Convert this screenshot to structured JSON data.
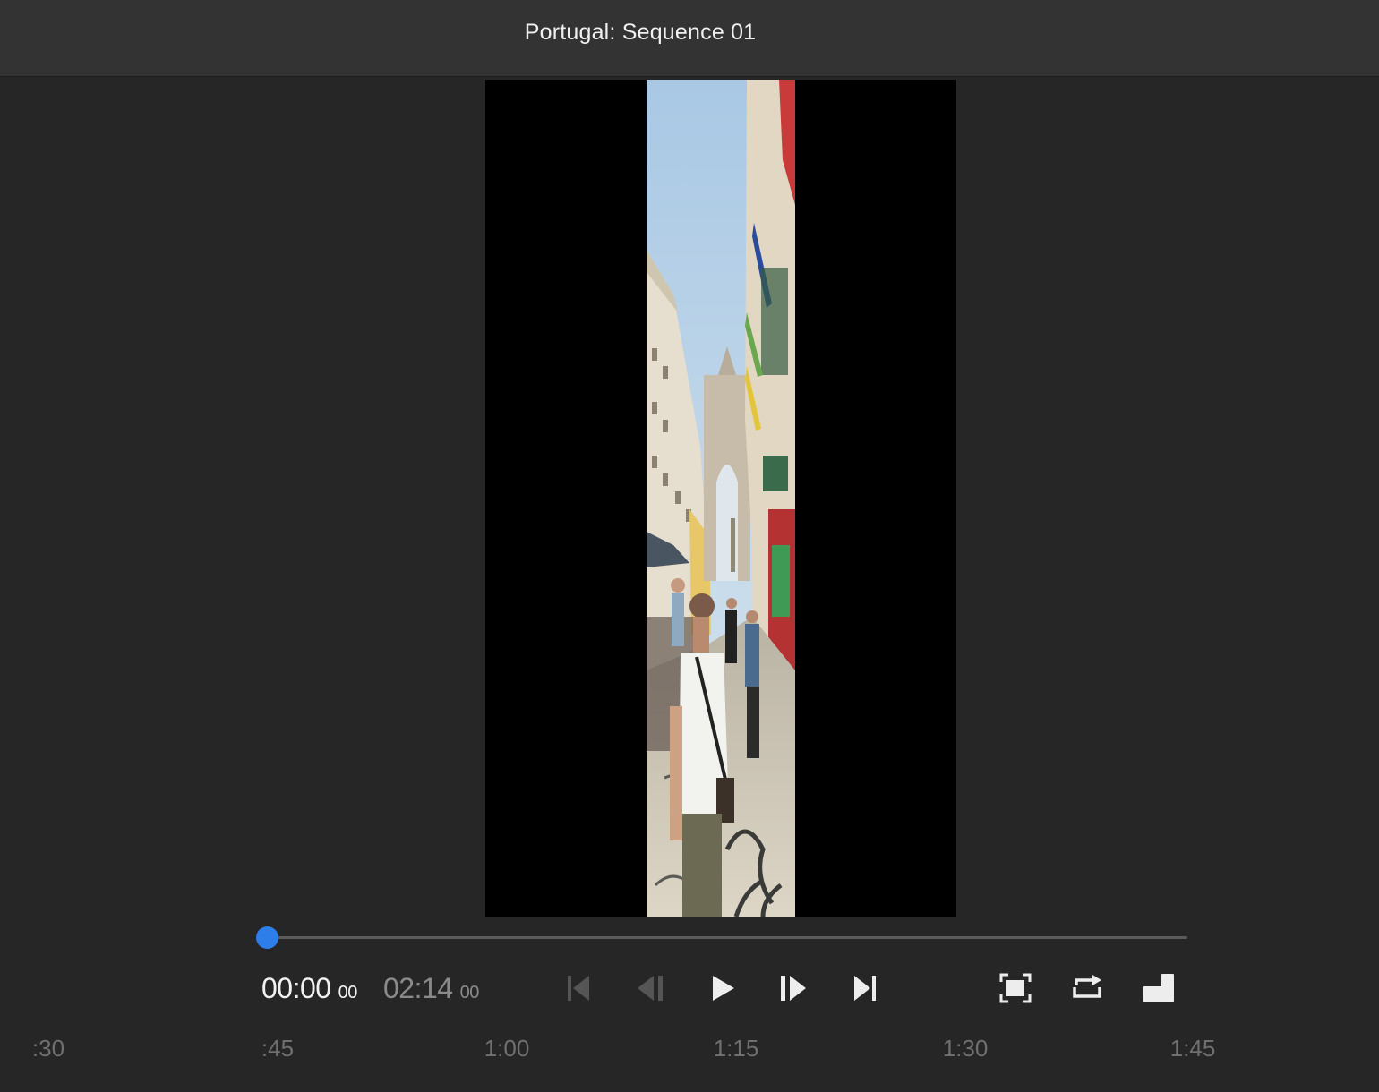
{
  "window": {
    "title": "Portugal: Sequence 01"
  },
  "player": {
    "current_time": "00:00",
    "current_frames": "00",
    "duration_time": "02:14",
    "duration_frames": "00",
    "progress": 0.0
  },
  "controls": [
    {
      "name": "go-to-start-button",
      "icon": "skip-to-start-icon",
      "enabled": false
    },
    {
      "name": "step-back-button",
      "icon": "step-back-icon",
      "enabled": false
    },
    {
      "name": "play-button",
      "icon": "play-icon",
      "enabled": true
    },
    {
      "name": "step-forward-button",
      "icon": "step-forward-icon",
      "enabled": true
    },
    {
      "name": "go-to-end-button",
      "icon": "skip-to-end-icon",
      "enabled": true
    },
    {
      "name": "fit-frame-button",
      "icon": "fit-frame-icon",
      "enabled": true
    },
    {
      "name": "loop-button",
      "icon": "loop-icon",
      "enabled": true
    },
    {
      "name": "export-frame-button",
      "icon": "export-frame-icon",
      "enabled": true
    }
  ],
  "ruler": {
    "labels": [
      ":30",
      ":45",
      "1:00",
      "1:15",
      "1:30",
      "1:45"
    ]
  },
  "colors": {
    "accent": "#2d7ee8",
    "background": "#262626",
    "titlebar": "#333333",
    "viewer": "#000000"
  }
}
